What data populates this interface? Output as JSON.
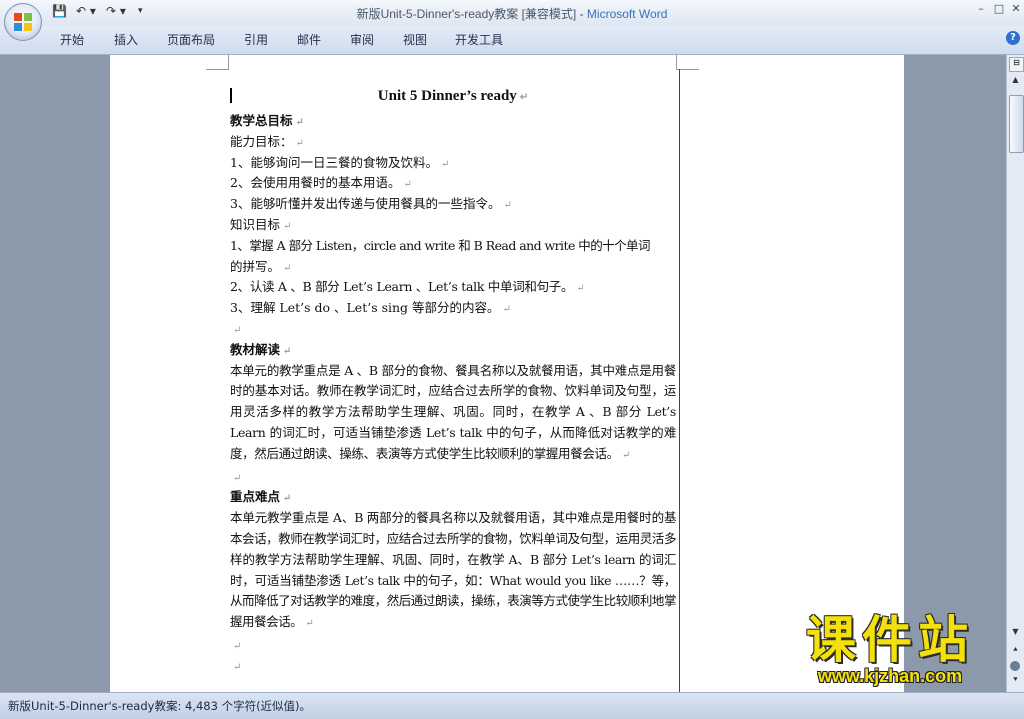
{
  "window": {
    "doc_name": "新版Unit-5-Dinner's-ready教案 [兼容模式] - ",
    "app_name": "Microsoft Word",
    "min": "–",
    "max": "□",
    "close": "✕"
  },
  "qat": {
    "save": "💾",
    "undo": "↶ ▾",
    "redo": "↷ ▾",
    "more": "▾"
  },
  "ribbon_tabs": [
    "开始",
    "插入",
    "页面布局",
    "引用",
    "邮件",
    "审阅",
    "视图",
    "开发工具"
  ],
  "help": "?",
  "icons": {
    "office_button": "office-logo",
    "save": "save-icon",
    "undo": "undo-icon",
    "redo": "redo-icon",
    "help": "help-icon"
  },
  "document": {
    "title": "Unit 5 Dinner’s ready",
    "mark": "↵",
    "lines": [
      "教学总目标",
      "能力目标：",
      "1、能够询问一日三餐的食物及饮料。",
      "2、会使用用餐时的基本用语。",
      "3、能够听懂并发出传递与使用餐具的一些指令。",
      "知识目标",
      "1、掌握 A  部分  Listen，circle and write 和 B Read and write 中的十个单词",
      "的拼写。",
      "2、认读 A 、B 部分  Let’s Learn  、Let’s talk 中单词和句子。",
      "3、理解 Let’s do  、Let’s sing  等部分的内容。",
      "",
      "教材解读",
      "本单元的教学重点是 A 、B 部分的食物、餐具名称以及就餐用语，其中难点是用餐时的基本对话。教师在教学词汇时，应结合过去所学的食物、饮料单词及句型，运用灵活多样的教学方法帮助学生理解、巩固。同时，在教学 A 、B 部分 Let’s Learn 的词汇时，可适当铺垫渗透 Let’s talk 中的句子，从而降低对话教学的难度，然后通过朗读、操练、表演等方式使学生比较顺利的掌握用餐会话。",
      "",
      "重点难点",
      "本单元教学重点是 A、B 两部分的餐具名称以及就餐用语，其中难点是用餐时的基本会话，教师在教学词汇时，应结合过去所学的食物，饮料单词及句型，运用灵活多样的教学方法帮助学生理解、巩固、同时，在教学 A、B 部分 Let’s learn  的词汇时，可适当铺垫渗透 Let’s talk  中的句子，如：What would you like  ……？等，从而降低了对话教学的难度，然后通过朗读，操练，表演等方式使学生比较顺利地掌握用餐会话。",
      "",
      ""
    ]
  },
  "scrollbar": {
    "ruler": "⊟",
    "up": "▲",
    "down": "▼",
    "prev_page": "⯅",
    "next_page": "⯆"
  },
  "status": {
    "text": "新版Unit-5-Dinner's-ready教案: 4,483 个字符(近似值)。"
  },
  "watermark": {
    "chinese": "课件站",
    "url": "www.kjzhan.com"
  }
}
